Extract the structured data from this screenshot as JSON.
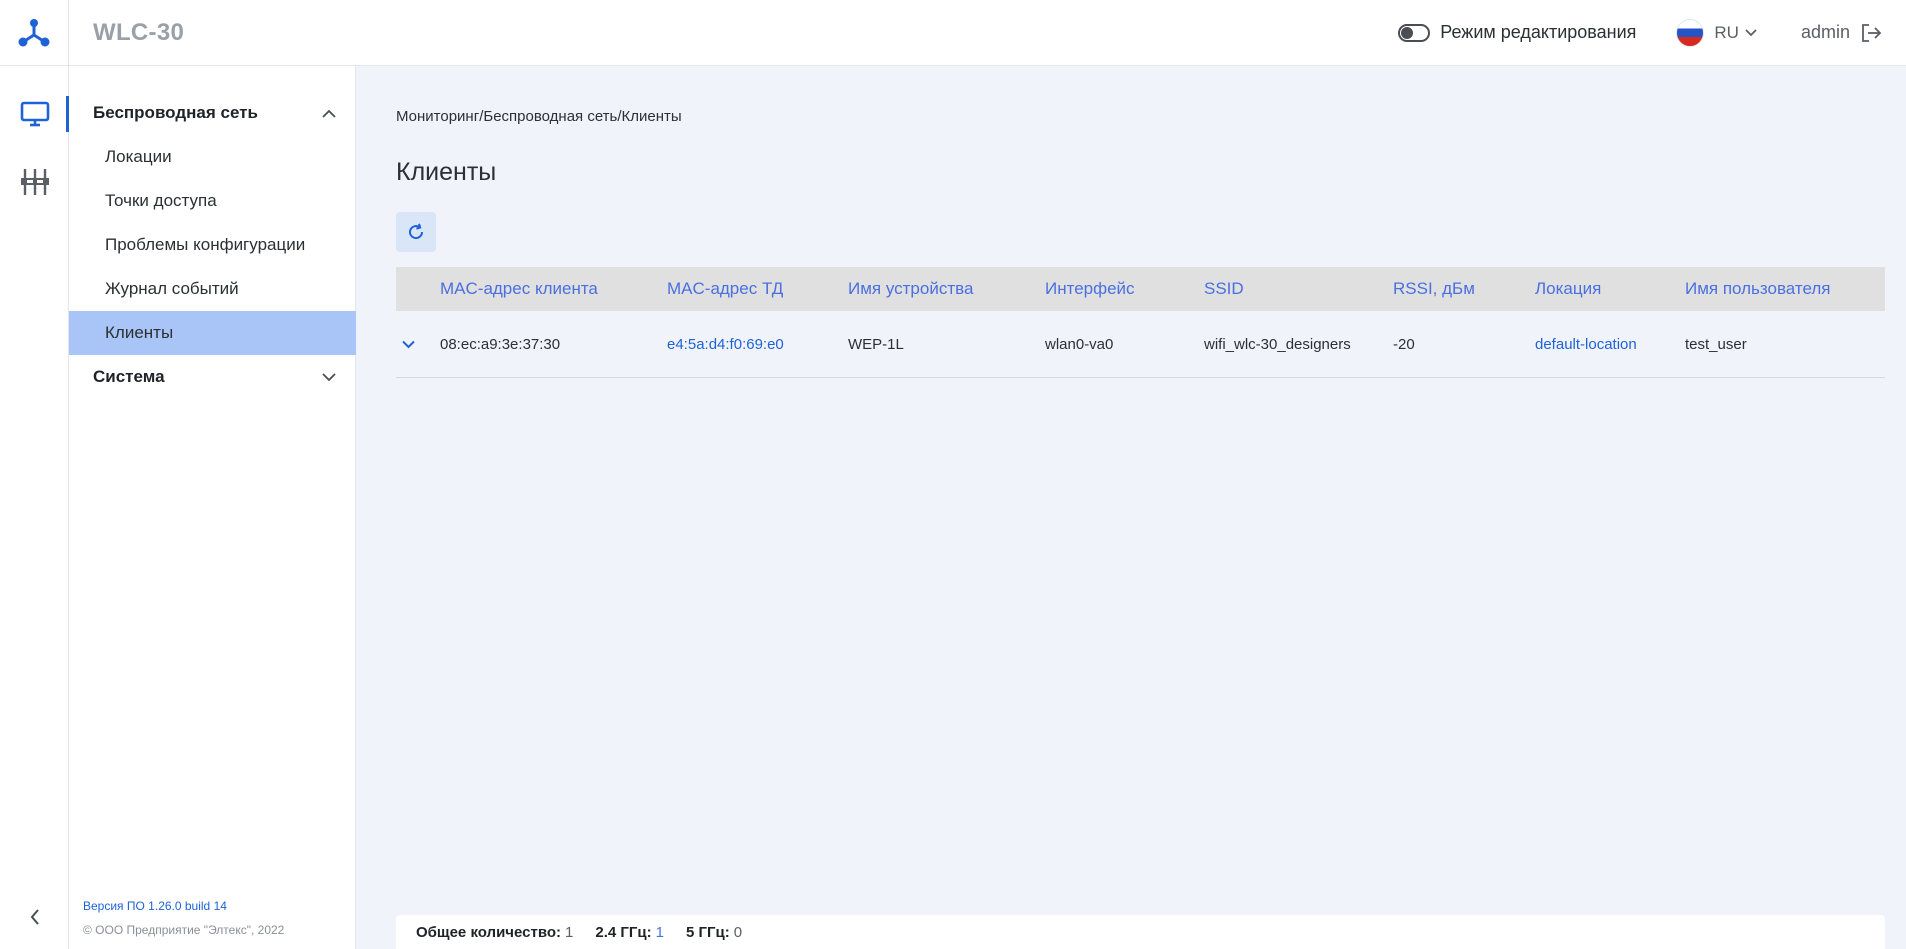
{
  "header": {
    "app_title": "WLC-30",
    "edit_mode_label": "Режим редактирования",
    "lang": "RU",
    "user": "admin"
  },
  "sidebar": {
    "groups": [
      {
        "label": "Беспроводная сеть",
        "expanded": true
      },
      {
        "label": "Система",
        "expanded": false
      }
    ],
    "items": [
      {
        "label": "Локации"
      },
      {
        "label": "Точки доступа"
      },
      {
        "label": "Проблемы конфигурации"
      },
      {
        "label": "Журнал событий"
      },
      {
        "label": "Клиенты",
        "active": true
      }
    ],
    "version": "Версия ПО 1.26.0 build 14",
    "copyright": "© ООО Предприятие \"Элтекс\", 2022"
  },
  "main": {
    "breadcrumb": "Мониторинг/Беспроводная сеть/Клиенты",
    "title": "Клиенты",
    "columns": [
      "MAC-адрес клиента",
      "MAC-адрес ТД",
      "Имя устройства",
      "Интерфейс",
      "SSID",
      "RSSI, дБм",
      "Локация",
      "Имя пользователя"
    ],
    "rows": [
      {
        "client_mac": "08:ec:a9:3e:37:30",
        "ap_mac": "e4:5a:d4:f0:69:e0",
        "device_name": "WEP-1L",
        "interface": "wlan0-va0",
        "ssid": "wifi_wlc-30_designers",
        "rssi": "-20",
        "location": "default-location",
        "username": "test_user"
      }
    ],
    "footer": {
      "total_label": "Общее количество:",
      "total_value": "1",
      "ghz24_label": "2.4 ГГц:",
      "ghz24_value": "1",
      "ghz5_label": "5 ГГц:",
      "ghz5_value": "0"
    }
  },
  "colors": {
    "accent": "#1f62d6",
    "header_link": "#4a6fe0",
    "active_item_bg": "#a9c5f7",
    "content_bg": "#f0f4fa"
  }
}
